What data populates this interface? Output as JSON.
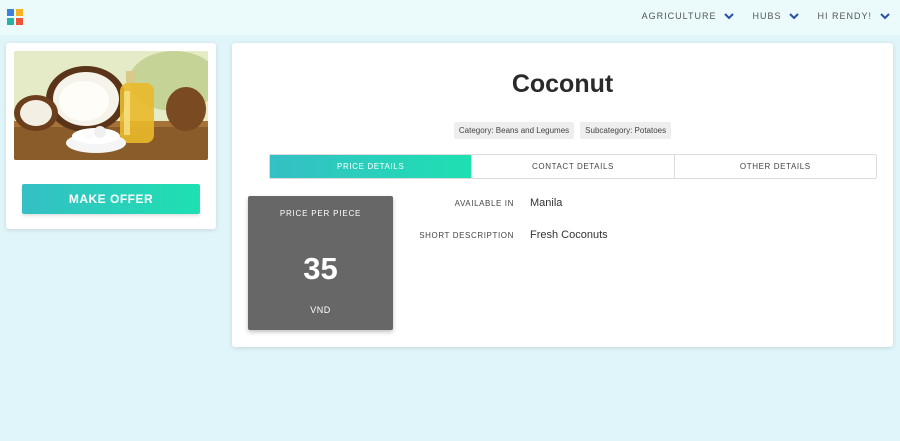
{
  "header": {
    "nav": [
      {
        "label": "AGRICULTURE"
      },
      {
        "label": "HUBS"
      },
      {
        "label": "HI RENDY!"
      }
    ]
  },
  "sidebar": {
    "make_offer_label": "MAKE OFFER"
  },
  "product": {
    "title": "Coconut",
    "category": "Category: Beans and Legumes",
    "subcategory": "Subcategory: Potatoes"
  },
  "tabs": [
    {
      "label": "PRICE DETAILS",
      "active": true
    },
    {
      "label": "CONTACT DETAILS",
      "active": false
    },
    {
      "label": "OTHER DETAILS",
      "active": false
    }
  ],
  "price": {
    "label": "PRICE PER PIECE",
    "value": "35",
    "currency": "VND"
  },
  "details": [
    {
      "key": "AVAILABLE IN",
      "value": "Manila"
    },
    {
      "key": "SHORT DESCRIPTION",
      "value": "Fresh Coconuts"
    }
  ],
  "colors": {
    "accent_start": "#35bfc4",
    "accent_end": "#1ee0b2",
    "page_bg": "#dff5fa",
    "price_box": "#676767"
  },
  "icons": [
    "app-logo-icon",
    "chevron-down-icon"
  ]
}
